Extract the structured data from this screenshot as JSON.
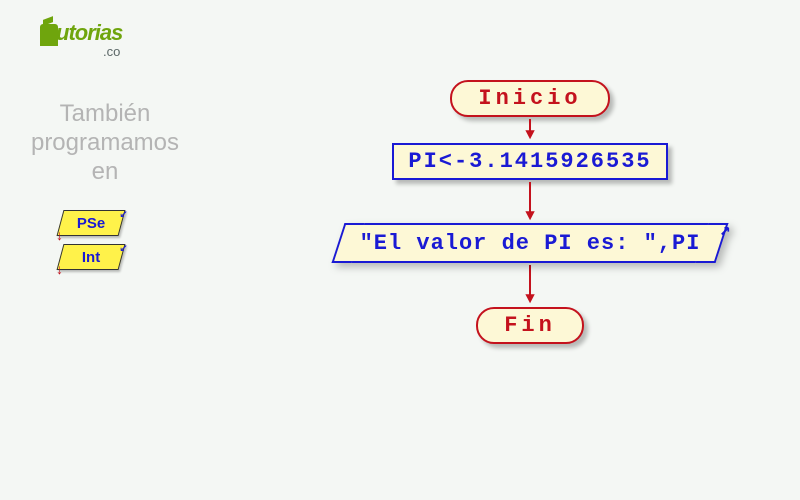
{
  "logo": {
    "main": "utorias",
    "sub": ".co"
  },
  "sidebar": {
    "text_line1": "También",
    "text_line2": "programamos",
    "text_line3": "en",
    "badges": [
      "PSe",
      "Int"
    ]
  },
  "flowchart": {
    "start": "Inicio",
    "process": "PI<-3.1415926535",
    "output": "\"El valor de PI es: \",PI",
    "end": "Fin"
  }
}
